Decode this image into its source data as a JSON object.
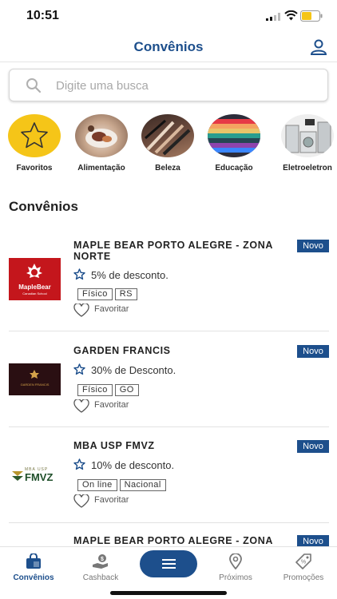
{
  "status_bar": {
    "time": "10:51"
  },
  "header": {
    "title": "Convênios"
  },
  "search": {
    "placeholder": "Digite uma busca"
  },
  "categories": [
    {
      "label": "Favoritos",
      "icon": "star-icon"
    },
    {
      "label": "Alimentação",
      "icon": "food-photo"
    },
    {
      "label": "Beleza",
      "icon": "makeup-brushes-photo"
    },
    {
      "label": "Educação",
      "icon": "colored-pencils-photo"
    },
    {
      "label": "Eletroeletron",
      "icon": "appliances-photo"
    }
  ],
  "section_title": "Convênios",
  "partners": [
    {
      "name": "MAPLE BEAR PORTO ALEGRE - ZONA NORTE",
      "badge": "Novo",
      "discount": "5% de desconto.",
      "tags": [
        "Físico",
        "RS"
      ],
      "favorite_label": "Favoritar",
      "logo_text": "MapleBear",
      "logo_sub": "Canadian School"
    },
    {
      "name": "GARDEN FRANCIS",
      "badge": "Novo",
      "discount": "30% de Desconto.",
      "tags": [
        "Físico",
        "GO"
      ],
      "favorite_label": "Favoritar",
      "logo_text": "GARDEN FRANCIS"
    },
    {
      "name": "MBA USP FMVZ",
      "badge": "Novo",
      "discount": "10% de desconto.",
      "tags": [
        "On line",
        "Nacional"
      ],
      "favorite_label": "Favoritar",
      "logo_text_top": "MBA USP",
      "logo_text": "FMVZ"
    },
    {
      "name": "MAPLE BEAR PORTO ALEGRE - ZONA SUL",
      "badge": "Novo"
    }
  ],
  "tabbar": {
    "items": [
      {
        "label": "Convênios",
        "icon": "shopping-bag-icon",
        "active": true
      },
      {
        "label": "Cashback",
        "icon": "cashback-hand-icon",
        "active": false
      },
      {
        "label": "Próximos",
        "icon": "map-pin-icon",
        "active": false
      },
      {
        "label": "Promoções",
        "icon": "price-tag-icon",
        "active": false
      }
    ],
    "menu_icon": "hamburger-menu-icon"
  },
  "colors": {
    "primary": "#1d4f8c",
    "star_yellow": "#f5c518",
    "maple_red": "#c4161c"
  }
}
